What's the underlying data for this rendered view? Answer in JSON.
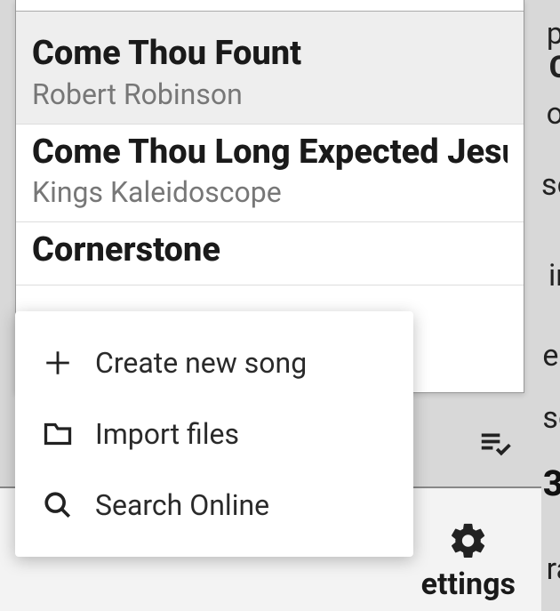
{
  "songs": [
    {
      "title": "Come Thou Fount",
      "artist": "Robert Robinson"
    },
    {
      "title": "Come Thou Long Expected Jesus",
      "artist": "Kings Kaleidoscope"
    },
    {
      "title": "Cornerstone",
      "artist": ""
    }
  ],
  "popup": {
    "create_label": "Create new song",
    "import_label": "Import files",
    "search_label": "Search Online"
  },
  "nav": {
    "settings_label": "ettings"
  },
  "bg": {
    "c0": "p",
    "c1": "C",
    "c2": "o",
    "c3": "so",
    "c4": "in",
    "c5": "es",
    "c6": "se",
    "c7": "ra",
    "three": "3"
  }
}
